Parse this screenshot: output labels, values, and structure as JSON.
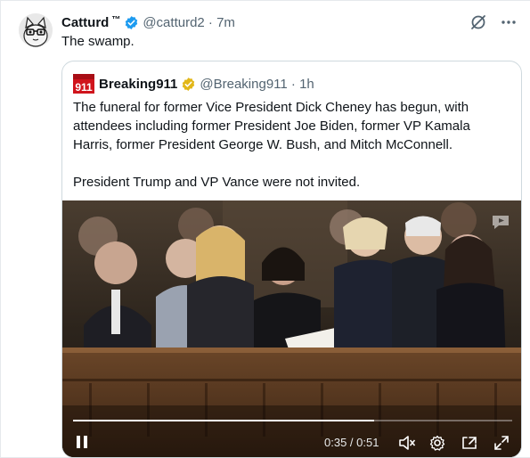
{
  "tweet": {
    "author_name": "Catturd",
    "author_tm": "™",
    "handle_time": "@catturd2 · 7m",
    "text": "The swamp.",
    "verified": true
  },
  "quote": {
    "logo_text": "911",
    "author_name": "Breaking911",
    "handle_time": "@Breaking911 · 1h",
    "paragraphs": [
      "The funeral for former Vice President Dick Cheney has begun, with attendees including former President Joe Biden, former VP Kamala Harris, former President George W. Bush, and Mitch McConnell.",
      "President Trump and VP Vance were not invited."
    ],
    "verified_gold": true
  },
  "video": {
    "time_display": "0:35 / 0:51",
    "progress_fraction": 0.686
  },
  "icons": {
    "top": [
      "grok-icon",
      "more-icon"
    ],
    "controls": [
      "pause-icon",
      "mute-icon",
      "settings-icon",
      "pop-out-icon",
      "fullscreen-icon"
    ]
  },
  "colors": {
    "verified_blue": "#1d9bf0",
    "verified_gold": "#e2b719",
    "handle_gray": "#536471",
    "border": "#cfd9de"
  }
}
